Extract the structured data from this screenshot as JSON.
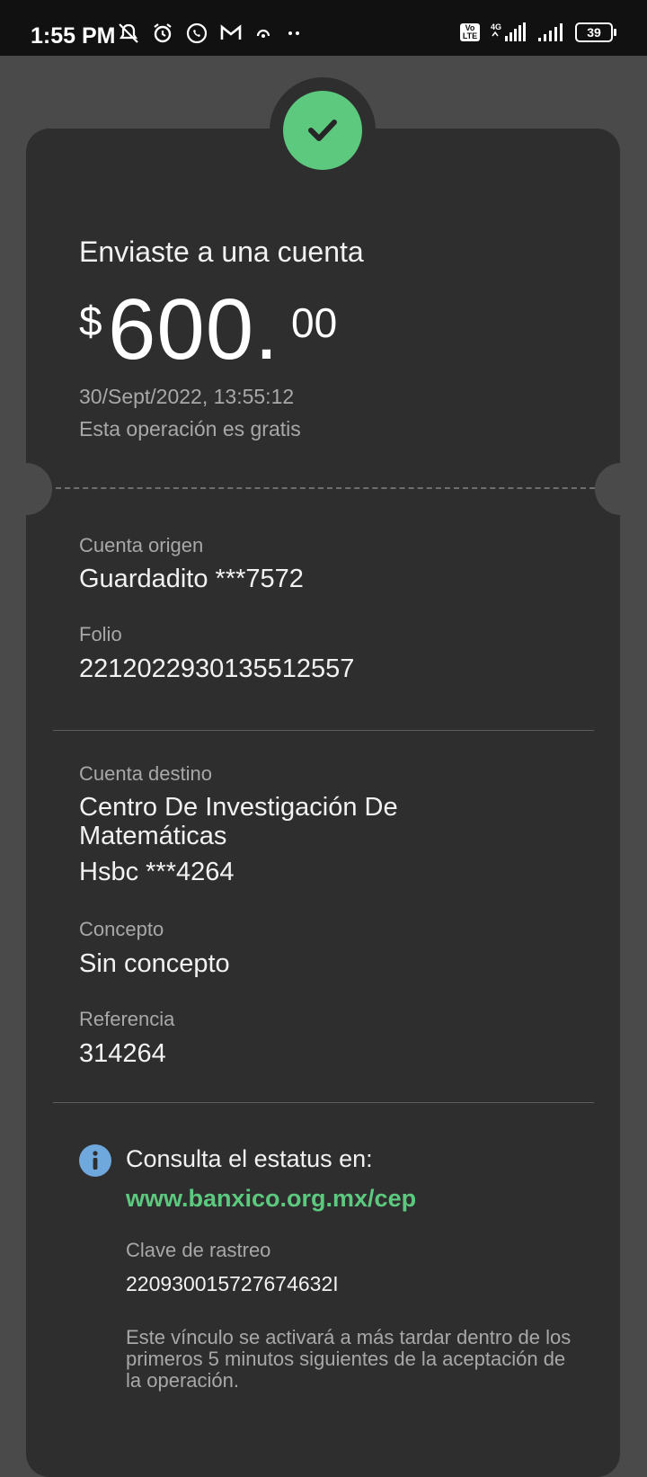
{
  "status_bar": {
    "time": "1:55 PM",
    "volte": "Vo LTE",
    "network": "4G",
    "battery": "39",
    "icons": [
      "mute-icon",
      "alarm-icon",
      "whatsapp-icon",
      "gmail-icon",
      "hotspot-icon",
      "more-dots-icon"
    ]
  },
  "receipt": {
    "title": "Enviaste a una cuenta",
    "currency": "$",
    "amount_int": "600.",
    "amount_dec": "00",
    "datetime": "30/Sept/2022, 13:55:12",
    "fee_note": "Esta operación es gratis"
  },
  "details": {
    "origen_label": "Cuenta origen",
    "origen_value": "Guardadito ***7572",
    "folio_label": "Folio",
    "folio_value": "2212022930135512557",
    "destino_label": "Cuenta destino",
    "destino_line1": "Centro De Investigación De",
    "destino_line2": "Matemáticas",
    "destino_line3": "Hsbc ***4264",
    "concepto_label": "Concepto",
    "concepto_value": "Sin concepto",
    "referencia_label": "Referencia",
    "referencia_value": "314264"
  },
  "status_info": {
    "consulta": "Consulta el estatus en:",
    "link": "www.banxico.org.mx/cep",
    "clave_label": "Clave de rastreo",
    "clave_value": "220930015727674632I",
    "note": "Este vínculo se activará a más tardar dentro de los primeros 5 minutos siguientes de la aceptación de la operación."
  },
  "colors": {
    "accent_green": "#5cc97f",
    "info_blue": "#6fa8dc",
    "card_bg": "#2e2e2e",
    "page_bg": "#4a4a4a"
  }
}
